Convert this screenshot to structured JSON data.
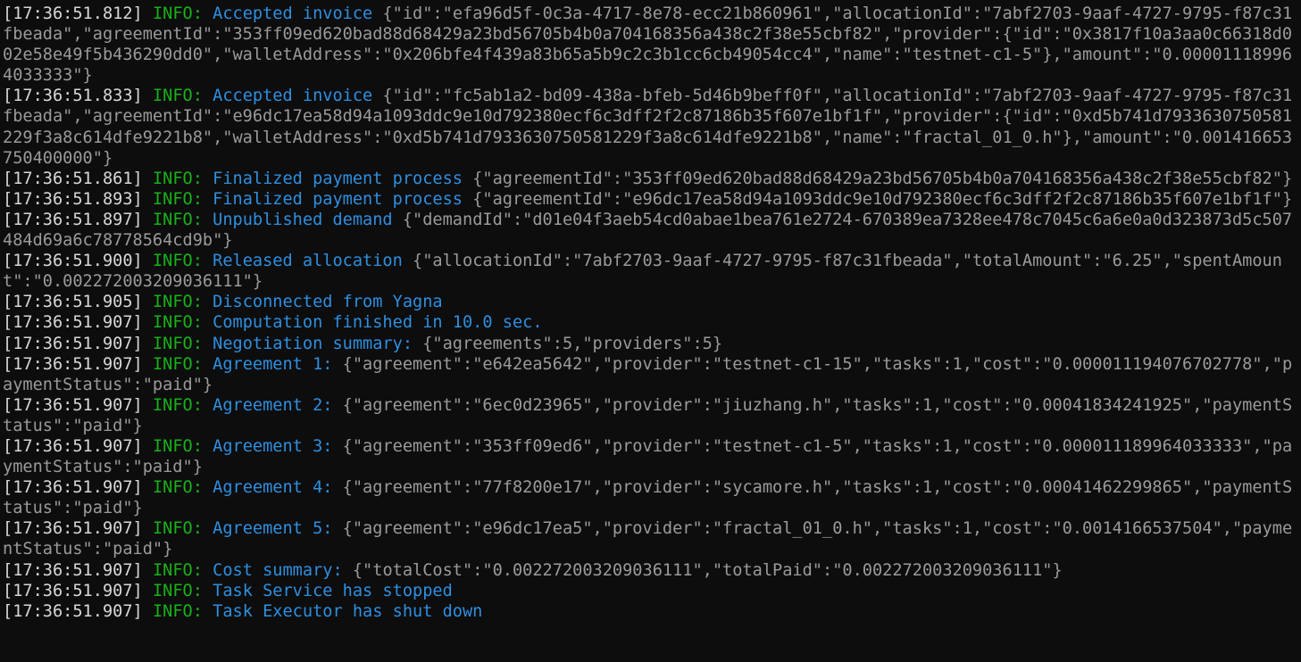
{
  "terminal": {
    "background_color": "#0d0d0d",
    "timestamp_color": "#d8d8d8",
    "level_color": "#18b218",
    "message_color": "#2e8fe0",
    "payload_color": "#9a9a9a",
    "lines": [
      {
        "timestamp": "[17:36:51.812]",
        "level": "INFO:",
        "message": "Accepted invoice",
        "payload": "{\"id\":\"efa96d5f-0c3a-4717-8e78-ecc21b860961\",\"allocationId\":\"7abf2703-9aaf-4727-9795-f87c31fbeada\",\"agreementId\":\"353ff09ed620bad88d68429a23bd56705b4b0a704168356a438c2f38e55cbf82\",\"provider\":{\"id\":\"0x3817f10a3aa0c66318d002e58e49f5b436290dd0\",\"walletAddress\":\"0x206bfe4f439a83b65a5b9c2c3b1cc6cb49054cc4\",\"name\":\"testnet-c1-5\"},\"amount\":\"0.000011189964033333\"}"
      },
      {
        "timestamp": "[17:36:51.833]",
        "level": "INFO:",
        "message": "Accepted invoice",
        "payload": "{\"id\":\"fc5ab1a2-bd09-438a-bfeb-5d46b9beff0f\",\"allocationId\":\"7abf2703-9aaf-4727-9795-f87c31fbeada\",\"agreementId\":\"e96dc17ea58d94a1093ddc9e10d792380ecf6c3dff2f2c87186b35f607e1bf1f\",\"provider\":{\"id\":\"0xd5b741d7933630750581229f3a8c614dfe9221b8\",\"walletAddress\":\"0xd5b741d7933630750581229f3a8c614dfe9221b8\",\"name\":\"fractal_01_0.h\"},\"amount\":\"0.001416653750400000\"}"
      },
      {
        "timestamp": "[17:36:51.861]",
        "level": "INFO:",
        "message": "Finalized payment process",
        "payload": "{\"agreementId\":\"353ff09ed620bad88d68429a23bd56705b4b0a704168356a438c2f38e55cbf82\"}"
      },
      {
        "timestamp": "[17:36:51.893]",
        "level": "INFO:",
        "message": "Finalized payment process",
        "payload": "{\"agreementId\":\"e96dc17ea58d94a1093ddc9e10d792380ecf6c3dff2f2c87186b35f607e1bf1f\"}"
      },
      {
        "timestamp": "[17:36:51.897]",
        "level": "INFO:",
        "message": "Unpublished demand",
        "payload": "{\"demandId\":\"d01e04f3aeb54cd0abae1bea761e2724-670389ea7328ee478c7045c6a6e0a0d323873d5c507484d69a6c78778564cd9b\"}"
      },
      {
        "timestamp": "[17:36:51.900]",
        "level": "INFO:",
        "message": "Released allocation",
        "payload": "{\"allocationId\":\"7abf2703-9aaf-4727-9795-f87c31fbeada\",\"totalAmount\":\"6.25\",\"spentAmount\":\"0.002272003209036111\"}"
      },
      {
        "timestamp": "[17:36:51.905]",
        "level": "INFO:",
        "message": "Disconnected from Yagna",
        "payload": ""
      },
      {
        "timestamp": "[17:36:51.907]",
        "level": "INFO:",
        "message": "Computation finished in 10.0 sec.",
        "payload": ""
      },
      {
        "timestamp": "[17:36:51.907]",
        "level": "INFO:",
        "message": "Negotiation summary:",
        "payload": "{\"agreements\":5,\"providers\":5}"
      },
      {
        "timestamp": "[17:36:51.907]",
        "level": "INFO:",
        "message": "Agreement 1:",
        "payload": "{\"agreement\":\"e642ea5642\",\"provider\":\"testnet-c1-15\",\"tasks\":1,\"cost\":\"0.000011194076702778\",\"paymentStatus\":\"paid\"}"
      },
      {
        "timestamp": "[17:36:51.907]",
        "level": "INFO:",
        "message": "Agreement 2:",
        "payload": "{\"agreement\":\"6ec0d23965\",\"provider\":\"jiuzhang.h\",\"tasks\":1,\"cost\":\"0.00041834241925\",\"paymentStatus\":\"paid\"}"
      },
      {
        "timestamp": "[17:36:51.907]",
        "level": "INFO:",
        "message": "Agreement 3:",
        "payload": "{\"agreement\":\"353ff09ed6\",\"provider\":\"testnet-c1-5\",\"tasks\":1,\"cost\":\"0.000011189964033333\",\"paymentStatus\":\"paid\"}"
      },
      {
        "timestamp": "[17:36:51.907]",
        "level": "INFO:",
        "message": "Agreement 4:",
        "payload": "{\"agreement\":\"77f8200e17\",\"provider\":\"sycamore.h\",\"tasks\":1,\"cost\":\"0.00041462299865\",\"paymentStatus\":\"paid\"}"
      },
      {
        "timestamp": "[17:36:51.907]",
        "level": "INFO:",
        "message": "Agreement 5:",
        "payload": "{\"agreement\":\"e96dc17ea5\",\"provider\":\"fractal_01_0.h\",\"tasks\":1,\"cost\":\"0.0014166537504\",\"paymentStatus\":\"paid\"}"
      },
      {
        "timestamp": "[17:36:51.907]",
        "level": "INFO:",
        "message": "Cost summary:",
        "payload": "{\"totalCost\":\"0.002272003209036111\",\"totalPaid\":\"0.002272003209036111\"}"
      },
      {
        "timestamp": "[17:36:51.907]",
        "level": "INFO:",
        "message": "Task Service has stopped",
        "payload": ""
      },
      {
        "timestamp": "[17:36:51.907]",
        "level": "INFO:",
        "message": "Task Executor has shut down",
        "payload": ""
      }
    ]
  }
}
